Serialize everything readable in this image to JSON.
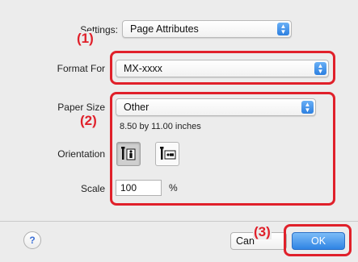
{
  "settings": {
    "label": "Settings:",
    "value": "Page Attributes"
  },
  "format_for": {
    "label": "Format For",
    "value": "MX-xxxx"
  },
  "paper_size": {
    "label": "Paper Size",
    "value": "Other",
    "dimensions": "8.50 by 11.00 inches"
  },
  "orientation": {
    "label": "Orientation",
    "options": [
      "portrait-icon",
      "landscape-icon"
    ],
    "selected": "portrait-icon"
  },
  "scale": {
    "label": "Scale",
    "value": "100",
    "unit": "%"
  },
  "annotations": {
    "step1": "(1)",
    "step2": "(2)",
    "step3": "(3)"
  },
  "footer": {
    "help": "?",
    "cancel_label": "Can",
    "ok_label": "OK"
  },
  "colors": {
    "annotation_red": "#e0202a",
    "accent_blue": "#2f84e4"
  }
}
